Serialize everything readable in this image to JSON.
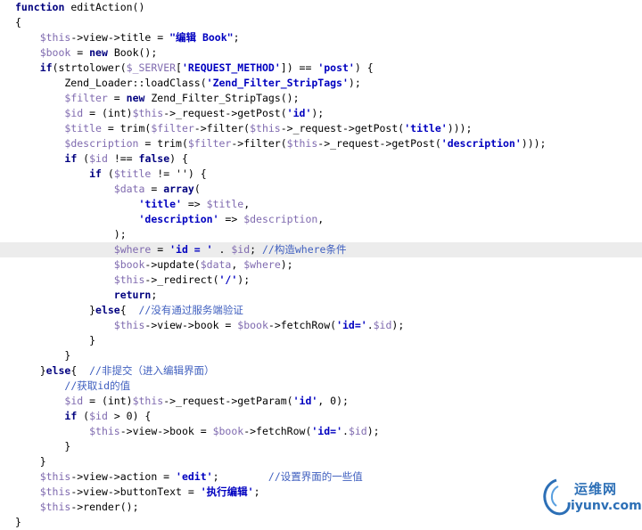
{
  "editor": {
    "language": "php",
    "lines": [
      {
        "segments": [
          [
            "kw",
            "function"
          ],
          [
            "fn",
            " editAction()"
          ]
        ]
      },
      {
        "segments": [
          [
            "fn",
            "{"
          ]
        ]
      },
      {
        "segments": [
          [
            "fn",
            "    "
          ],
          [
            "var",
            "$this"
          ],
          [
            "fn",
            "->view->title = "
          ],
          [
            "str",
            "\"编辑 Book\""
          ],
          [
            "fn",
            ";"
          ]
        ]
      },
      {
        "segments": [
          [
            "fn",
            "    "
          ],
          [
            "var",
            "$book"
          ],
          [
            "fn",
            " = "
          ],
          [
            "kw",
            "new"
          ],
          [
            "fn",
            " Book();"
          ]
        ]
      },
      {
        "segments": [
          [
            "fn",
            "    "
          ],
          [
            "kw",
            "if"
          ],
          [
            "fn",
            "(strtolower("
          ],
          [
            "var",
            "$_SERVER"
          ],
          [
            "fn",
            "["
          ],
          [
            "str",
            "'REQUEST_METHOD'"
          ],
          [
            "fn",
            "]) == "
          ],
          [
            "str",
            "'post'"
          ],
          [
            "fn",
            ") {"
          ]
        ]
      },
      {
        "segments": [
          [
            "fn",
            "        Zend_Loader::loadClass("
          ],
          [
            "str",
            "'Zend_Filter_StripTags'"
          ],
          [
            "fn",
            ");"
          ]
        ]
      },
      {
        "segments": [
          [
            "fn",
            "        "
          ],
          [
            "var",
            "$filter"
          ],
          [
            "fn",
            " = "
          ],
          [
            "kw",
            "new"
          ],
          [
            "fn",
            " Zend_Filter_StripTags();"
          ]
        ]
      },
      {
        "segments": [
          [
            "fn",
            "        "
          ],
          [
            "var",
            "$id"
          ],
          [
            "fn",
            " = (int)"
          ],
          [
            "var",
            "$this"
          ],
          [
            "fn",
            "->_request->getPost("
          ],
          [
            "str",
            "'id'"
          ],
          [
            "fn",
            ");"
          ]
        ]
      },
      {
        "segments": [
          [
            "fn",
            "        "
          ],
          [
            "var",
            "$title"
          ],
          [
            "fn",
            " = trim("
          ],
          [
            "var",
            "$filter"
          ],
          [
            "fn",
            "->filter("
          ],
          [
            "var",
            "$this"
          ],
          [
            "fn",
            "->_request->getPost("
          ],
          [
            "str",
            "'title'"
          ],
          [
            "fn",
            ")));"
          ]
        ]
      },
      {
        "segments": [
          [
            "fn",
            "        "
          ],
          [
            "var",
            "$description"
          ],
          [
            "fn",
            " = trim("
          ],
          [
            "var",
            "$filter"
          ],
          [
            "fn",
            "->filter("
          ],
          [
            "var",
            "$this"
          ],
          [
            "fn",
            "->_request->getPost("
          ],
          [
            "str",
            "'description'"
          ],
          [
            "fn",
            ")));"
          ]
        ]
      },
      {
        "segments": [
          [
            "fn",
            "        "
          ],
          [
            "kw",
            "if"
          ],
          [
            "fn",
            " ("
          ],
          [
            "var",
            "$id"
          ],
          [
            "fn",
            " !== "
          ],
          [
            "kw",
            "false"
          ],
          [
            "fn",
            ") {"
          ]
        ]
      },
      {
        "segments": [
          [
            "fn",
            "            "
          ],
          [
            "kw",
            "if"
          ],
          [
            "fn",
            " ("
          ],
          [
            "var",
            "$title"
          ],
          [
            "fn",
            " != '') {"
          ]
        ]
      },
      {
        "segments": [
          [
            "fn",
            "                "
          ],
          [
            "var",
            "$data"
          ],
          [
            "fn",
            " = "
          ],
          [
            "kw",
            "array"
          ],
          [
            "fn",
            "("
          ]
        ]
      },
      {
        "segments": [
          [
            "fn",
            "                    "
          ],
          [
            "str",
            "'title'"
          ],
          [
            "fn",
            " => "
          ],
          [
            "var",
            "$title"
          ],
          [
            "fn",
            ","
          ]
        ]
      },
      {
        "segments": [
          [
            "fn",
            "                    "
          ],
          [
            "str",
            "'description'"
          ],
          [
            "fn",
            " => "
          ],
          [
            "var",
            "$description"
          ],
          [
            "fn",
            ","
          ]
        ]
      },
      {
        "segments": [
          [
            "fn",
            "                );"
          ]
        ]
      },
      {
        "highlight": true,
        "segments": [
          [
            "fn",
            "                "
          ],
          [
            "var",
            "$where"
          ],
          [
            "fn",
            " = "
          ],
          [
            "str",
            "'id = '"
          ],
          [
            "fn",
            " . "
          ],
          [
            "var",
            "$id"
          ],
          [
            "fn",
            "; "
          ],
          [
            "cm",
            "//构造where条件"
          ]
        ]
      },
      {
        "segments": [
          [
            "fn",
            "                "
          ],
          [
            "var",
            "$book"
          ],
          [
            "fn",
            "->update("
          ],
          [
            "var",
            "$data"
          ],
          [
            "fn",
            ", "
          ],
          [
            "var",
            "$where"
          ],
          [
            "fn",
            ");"
          ]
        ]
      },
      {
        "segments": [
          [
            "fn",
            "                "
          ],
          [
            "var",
            "$this"
          ],
          [
            "fn",
            "->_redirect("
          ],
          [
            "str",
            "'/'"
          ],
          [
            "fn",
            ");"
          ]
        ]
      },
      {
        "segments": [
          [
            "fn",
            "                "
          ],
          [
            "kw",
            "return"
          ],
          [
            "fn",
            ";"
          ]
        ]
      },
      {
        "segments": [
          [
            "fn",
            "            }"
          ],
          [
            "kw",
            "else"
          ],
          [
            "fn",
            "{  "
          ],
          [
            "cm",
            "//没有通过服务端验证"
          ]
        ]
      },
      {
        "segments": [
          [
            "fn",
            "                "
          ],
          [
            "var",
            "$this"
          ],
          [
            "fn",
            "->view->book = "
          ],
          [
            "var",
            "$book"
          ],
          [
            "fn",
            "->fetchRow("
          ],
          [
            "str",
            "'id='"
          ],
          [
            "fn",
            "."
          ],
          [
            "var",
            "$id"
          ],
          [
            "fn",
            ");"
          ]
        ]
      },
      {
        "segments": [
          [
            "fn",
            "            }"
          ]
        ]
      },
      {
        "segments": [
          [
            "fn",
            "        }"
          ]
        ]
      },
      {
        "segments": [
          [
            "fn",
            "    }"
          ],
          [
            "kw",
            "else"
          ],
          [
            "fn",
            "{  "
          ],
          [
            "cm",
            "//非提交（进入编辑界面）"
          ]
        ]
      },
      {
        "segments": [
          [
            "fn",
            "        "
          ],
          [
            "cm",
            "//获取id的值"
          ]
        ]
      },
      {
        "segments": [
          [
            "fn",
            "        "
          ],
          [
            "var",
            "$id"
          ],
          [
            "fn",
            " = (int)"
          ],
          [
            "var",
            "$this"
          ],
          [
            "fn",
            "->_request->getParam("
          ],
          [
            "str",
            "'id'"
          ],
          [
            "fn",
            ", 0);"
          ]
        ]
      },
      {
        "segments": [
          [
            "fn",
            "        "
          ],
          [
            "kw",
            "if"
          ],
          [
            "fn",
            " ("
          ],
          [
            "var",
            "$id"
          ],
          [
            "fn",
            " > 0) {"
          ]
        ]
      },
      {
        "segments": [
          [
            "fn",
            "            "
          ],
          [
            "var",
            "$this"
          ],
          [
            "fn",
            "->view->book = "
          ],
          [
            "var",
            "$book"
          ],
          [
            "fn",
            "->fetchRow("
          ],
          [
            "str",
            "'id='"
          ],
          [
            "fn",
            "."
          ],
          [
            "var",
            "$id"
          ],
          [
            "fn",
            ");"
          ]
        ]
      },
      {
        "segments": [
          [
            "fn",
            "        }"
          ]
        ]
      },
      {
        "segments": [
          [
            "fn",
            "    }"
          ]
        ]
      },
      {
        "segments": [
          [
            "fn",
            "    "
          ],
          [
            "var",
            "$this"
          ],
          [
            "fn",
            "->view->action = "
          ],
          [
            "str",
            "'edit'"
          ],
          [
            "fn",
            ";        "
          ],
          [
            "cm",
            "//设置界面的一些值"
          ]
        ]
      },
      {
        "segments": [
          [
            "fn",
            "    "
          ],
          [
            "var",
            "$this"
          ],
          [
            "fn",
            "->view->buttonText = "
          ],
          [
            "str",
            "'执行编辑'"
          ],
          [
            "fn",
            ";"
          ]
        ]
      },
      {
        "segments": [
          [
            "fn",
            "    "
          ],
          [
            "var",
            "$this"
          ],
          [
            "fn",
            "->render();"
          ]
        ]
      },
      {
        "segments": [
          [
            "fn",
            "}"
          ]
        ]
      }
    ]
  },
  "watermark": {
    "brand": "运维网",
    "domain": "iyunv.com",
    "color": "#2c6fb6"
  }
}
